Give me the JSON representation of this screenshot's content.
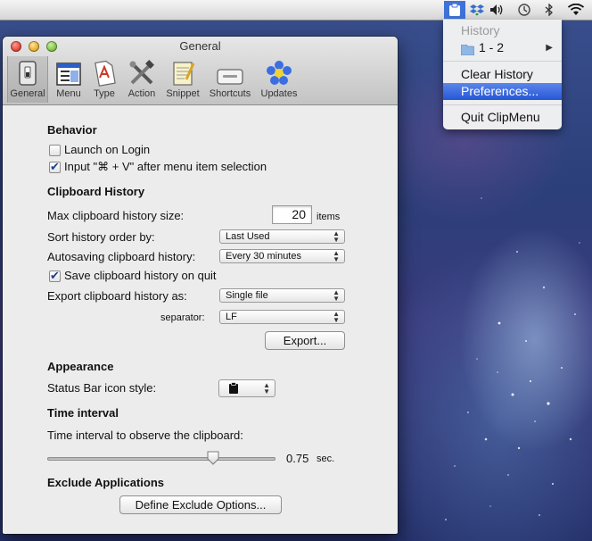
{
  "menubar": {
    "icons": [
      "clipmenu-icon",
      "dropbox-icon",
      "volume-icon",
      "time-machine-icon",
      "bluetooth-icon",
      "wifi-icon"
    ]
  },
  "menu": {
    "history_label": "History",
    "folder_label": "1 - 2",
    "clear_history": "Clear History",
    "preferences": "Preferences...",
    "quit": "Quit ClipMenu"
  },
  "window": {
    "title": "General",
    "toolbar": [
      {
        "name": "general",
        "label": "General",
        "icon": "switch-icon"
      },
      {
        "name": "menu",
        "label": "Menu",
        "icon": "menu-window-icon"
      },
      {
        "name": "type",
        "label": "Type",
        "icon": "document-type-icon"
      },
      {
        "name": "action",
        "label": "Action",
        "icon": "tools-icon"
      },
      {
        "name": "snippet",
        "label": "Snippet",
        "icon": "notepad-icon"
      },
      {
        "name": "shortcuts",
        "label": "Shortcuts",
        "icon": "keyboard-key-icon"
      },
      {
        "name": "updates",
        "label": "Updates",
        "icon": "flower-icon"
      }
    ],
    "selected_tab": "General"
  },
  "behavior": {
    "heading": "Behavior",
    "launch_on_login": "Launch on Login",
    "launch_on_login_checked": false,
    "input_paste": "Input \"⌘ + V\" after menu item selection",
    "input_paste_checked": true
  },
  "clipboard_history": {
    "heading": "Clipboard History",
    "max_size_label": "Max clipboard history size:",
    "max_size_value": "20",
    "max_size_unit": "items",
    "sort_label": "Sort history order by:",
    "sort_value": "Last Used",
    "autosave_label": "Autosaving clipboard history:",
    "autosave_value": "Every 30 minutes",
    "save_on_quit": "Save clipboard history on quit",
    "save_on_quit_checked": true,
    "export_as_label": "Export clipboard history as:",
    "export_as_value": "Single file",
    "separator_label": "separator:",
    "separator_value": "LF",
    "export_button": "Export..."
  },
  "appearance": {
    "heading": "Appearance",
    "icon_style_label": "Status Bar icon style:"
  },
  "time_interval": {
    "heading": "Time interval",
    "observe_label": "Time interval to observe the clipboard:",
    "value": "0.75",
    "unit": "sec.",
    "slider_fraction": 0.74
  },
  "exclude": {
    "heading": "Exclude Applications",
    "define_button": "Define Exclude Options..."
  },
  "colors": {
    "menu_highlight": "#2f63dd",
    "menubar_clip_bg": "#3f72d9"
  }
}
